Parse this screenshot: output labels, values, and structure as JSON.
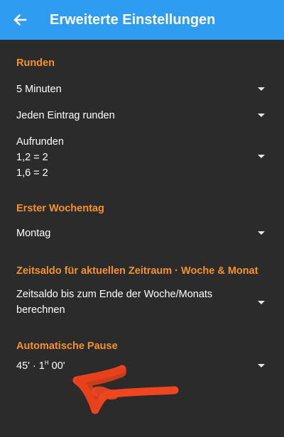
{
  "appbar": {
    "title": "Erweiterte Einstellungen",
    "back_icon": "arrow-left-icon",
    "background": "#2e9cf0"
  },
  "colors": {
    "accent": "#f5922b",
    "background": "#2b2b2b",
    "text": "#ffffff"
  },
  "sections": {
    "rounding": {
      "header": "Runden",
      "interval": "5 Minuten",
      "mode": "Jeden Eintrag runden",
      "direction_lines": [
        "Aufrunden",
        "1,2 = 2",
        "1,6 = 2"
      ]
    },
    "first_weekday": {
      "header": "Erster Wochentag",
      "value": "Montag"
    },
    "time_balance": {
      "header": "Zeitsaldo für aktuellen Zeitraum · Woche & Monat",
      "value_lines": [
        "Zeitsaldo bis zum Ende der Woche/Monats",
        "berechnen"
      ]
    },
    "auto_pause": {
      "header": "Automatische Pause",
      "value_prefix": "45' · 1",
      "value_sup": "H",
      "value_suffix": " 00'"
    }
  }
}
